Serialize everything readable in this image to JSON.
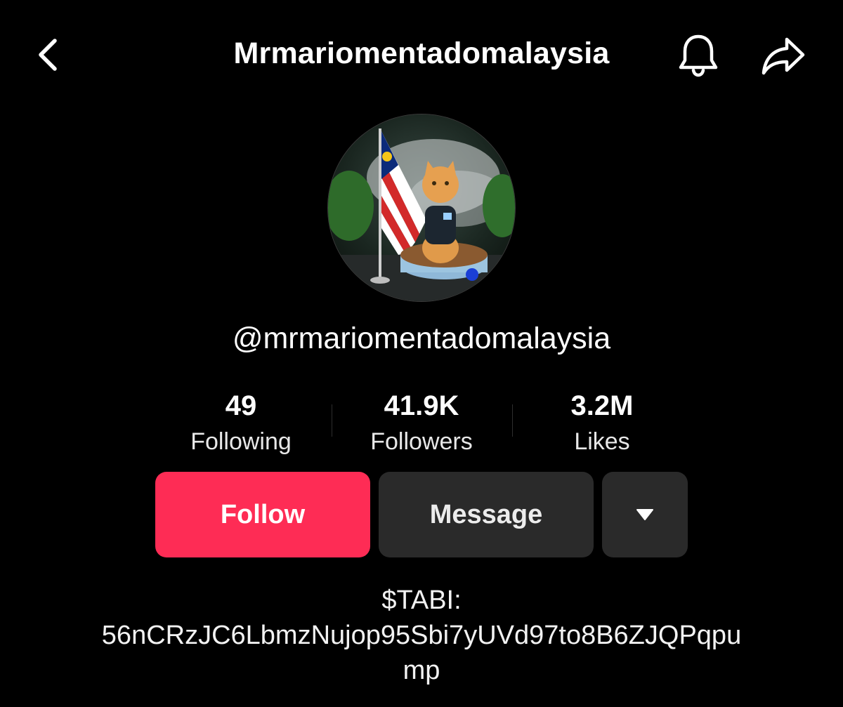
{
  "header": {
    "title": "Mrmariomentadomalaysia",
    "back_icon": "chevron-left-icon",
    "bell_icon": "bell-icon",
    "share_icon": "share-arrow-icon"
  },
  "profile": {
    "avatar_description": "orange cat with Malaysian flag",
    "handle": "@mrmariomentadomalaysia"
  },
  "stats": [
    {
      "value": "49",
      "label": "Following"
    },
    {
      "value": "41.9K",
      "label": "Followers"
    },
    {
      "value": "3.2M",
      "label": "Likes"
    }
  ],
  "actions": {
    "follow_label": "Follow",
    "message_label": "Message",
    "more_icon": "caret-down-icon"
  },
  "bio": {
    "line1": "$TABI:",
    "line2": "56nCRzJC6LbmzNujop95Sbi7yUVd97to8B6ZJQPqpu",
    "line3": "mp"
  },
  "colors": {
    "background": "#000000",
    "accent": "#fe2c55",
    "button_secondary": "#2a2a2a",
    "text": "#ffffff"
  }
}
